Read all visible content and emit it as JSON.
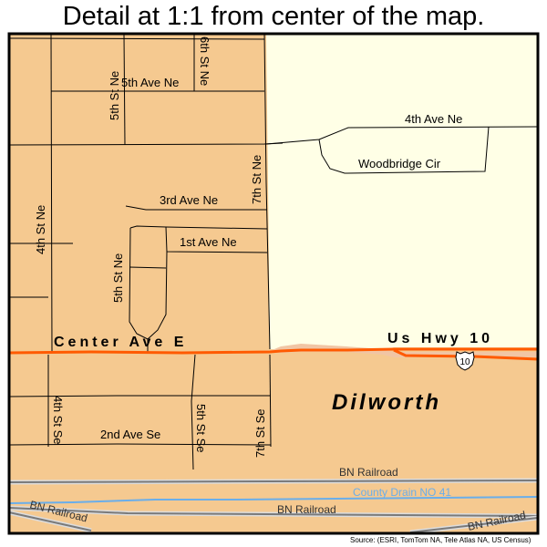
{
  "title": "Detail at 1:1 from center of the map.",
  "colors": {
    "city_area": "#f5c990",
    "outside_area": "#ffffe6",
    "highway": "#ff5a00",
    "railroad": "#7a7a7a",
    "railroad_casing": "#dcdcdc",
    "drain": "#6aaeea",
    "road": "#000000"
  },
  "map": {
    "city_label": "Dilworth",
    "highway_label": "Us Hwy 10",
    "highway_shield": "10",
    "streets": {
      "fifth_ave_ne": "5th Ave Ne",
      "fifth_st_ne_top": "5th St Ne",
      "sixth_st_ne": "6th St Ne",
      "fourth_ave_ne": "4th Ave Ne",
      "woodbridge_cir": "Woodbridge Cir",
      "seventh_st_ne": "7th St Ne",
      "fourth_st_ne": "4th St Ne",
      "third_ave_ne": "3rd Ave Ne",
      "first_ave_ne": "1st Ave Ne",
      "fifth_st_ne_mid": "5th St Ne",
      "center_ave_e": "Center Ave E",
      "fourth_st_se": "4th St Se",
      "second_ave_se": "2nd Ave Se",
      "fifth_st_se": "5th St Se",
      "seventh_st_se": "7th St Se"
    },
    "railroads": {
      "upper": "BN Railroad",
      "lower": "BN Railroad",
      "left_diag": "BN Railroad",
      "right_diag": "BN Railroad"
    },
    "drain_label": "County Drain NO 41",
    "source": "Source: (ESRI, TomTom NA, Tele Atlas NA, US Census)"
  }
}
